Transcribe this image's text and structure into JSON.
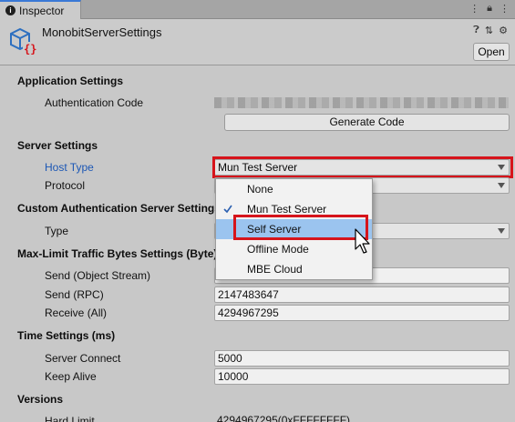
{
  "tab": {
    "label": "Inspector"
  },
  "header": {
    "object_name": "MonobitServerSettings",
    "open_label": "Open"
  },
  "app_settings": {
    "title": "Application Settings",
    "auth_code_label": "Authentication Code",
    "generate_label": "Generate Code"
  },
  "server_settings": {
    "title": "Server Settings",
    "host_type_label": "Host Type",
    "host_type_value": "Mun Test Server",
    "protocol_label": "Protocol"
  },
  "custom_auth": {
    "title": "Custom Authentication Server Settings",
    "type_label": "Type"
  },
  "traffic": {
    "title": "Max-Limit Traffic Bytes Settings (Byte)",
    "send_object_label": "Send (Object Stream)",
    "send_rpc_label": "Send (RPC)",
    "send_rpc_value": "2147483647",
    "receive_label": "Receive (All)",
    "receive_value": "4294967295"
  },
  "time": {
    "title": "Time Settings (ms)",
    "connect_label": "Server Connect",
    "connect_value": "5000",
    "keepalive_label": "Keep Alive",
    "keepalive_value": "10000"
  },
  "versions": {
    "title": "Versions",
    "hard_limit_label": "Hard Limit",
    "hard_limit_value": "4294967295(0xFFFFFFFF)"
  },
  "popup": {
    "options": [
      "None",
      "Mun Test Server",
      "Self Server",
      "Offline Mode",
      "MBE Cloud"
    ],
    "checked_option": "Mun Test Server",
    "highlighted_option": "Self Server"
  },
  "colors": {
    "accent": "#d6141b",
    "highlight": "#9bc4ef",
    "link_label": "#1c57b5"
  }
}
